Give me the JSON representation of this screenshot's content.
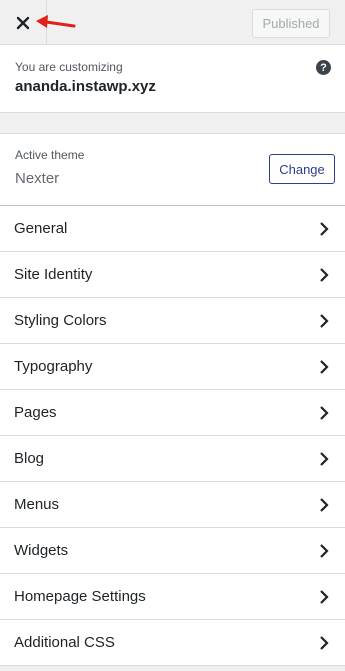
{
  "header": {
    "close_label": "Close",
    "publish_label": "Published"
  },
  "info": {
    "customizing_label": "You are customizing",
    "site_name": "ananda.instawp.xyz",
    "help_symbol": "?"
  },
  "theme": {
    "label": "Active theme",
    "name": "Nexter",
    "change_label": "Change"
  },
  "menu": {
    "items": [
      {
        "label": "General"
      },
      {
        "label": "Site Identity"
      },
      {
        "label": "Styling Colors"
      },
      {
        "label": "Typography"
      },
      {
        "label": "Pages"
      },
      {
        "label": "Blog"
      },
      {
        "label": "Menus"
      },
      {
        "label": "Widgets"
      },
      {
        "label": "Homepage Settings"
      },
      {
        "label": "Additional CSS"
      }
    ]
  },
  "colors": {
    "annotation_arrow": "#e0201a",
    "change_button": "#2c3e8f"
  }
}
